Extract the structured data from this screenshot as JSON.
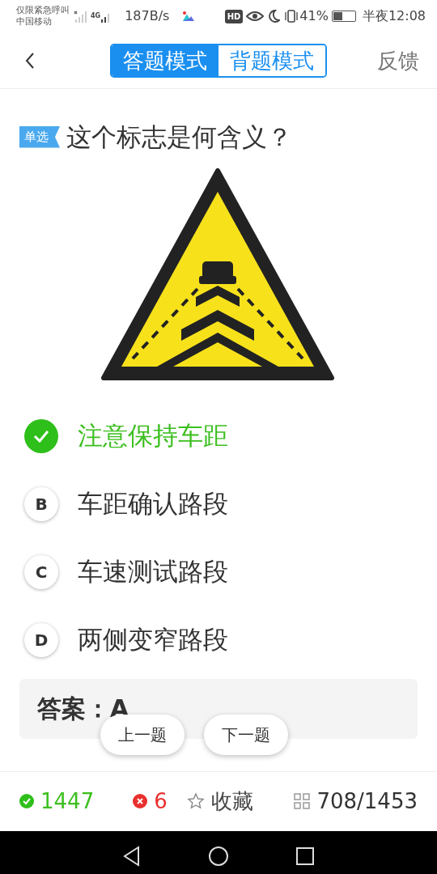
{
  "status_bar": {
    "carrier_lines": [
      "仅限紧急呼叫",
      "中国移动"
    ],
    "network": "4G",
    "speed": "187B/s",
    "hd": "HD",
    "battery_text": "41%",
    "battery": {
      "level": 0.41
    },
    "time": "半夜12:08"
  },
  "header": {
    "tabs": [
      {
        "label": "答题模式",
        "selected": true
      },
      {
        "label": "背题模式",
        "selected": false
      }
    ],
    "feedback": "反馈"
  },
  "question": {
    "type_tag": "单选",
    "text": "这个标志是何含义？",
    "image": {
      "kind": "sign"
    }
  },
  "options": [
    {
      "label": "注意保持车距",
      "correct": true
    },
    {
      "letter": "B",
      "label": "车距确认路段",
      "correct": false
    },
    {
      "letter": "C",
      "label": "车速测试路段",
      "correct": false
    },
    {
      "letter": "D",
      "label": "两侧变窄路段",
      "correct": false
    }
  ],
  "answer": "答案：A",
  "nav_buttons": [
    "上一题",
    "下一题"
  ],
  "footer": {
    "right_count": "1447",
    "wrong_count": "6",
    "favorite": "收藏",
    "progress": "708/1453"
  }
}
